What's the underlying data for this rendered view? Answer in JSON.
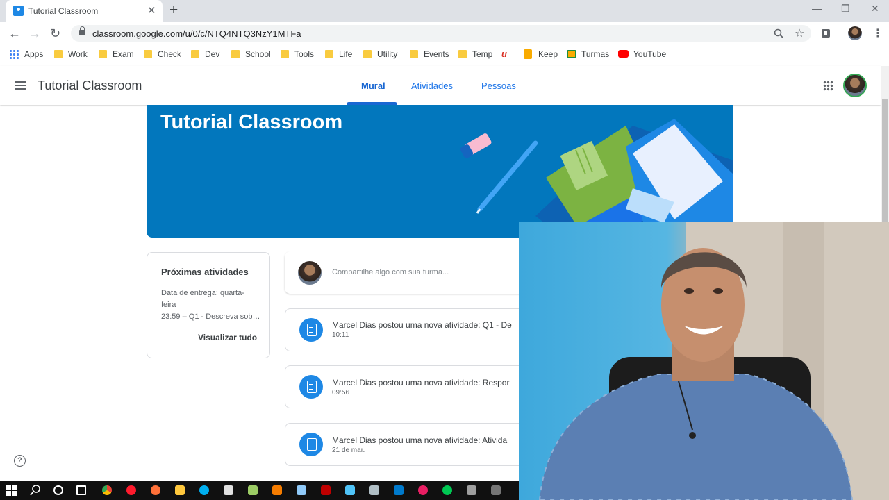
{
  "browser": {
    "tab_title": "Tutorial Classroom",
    "tab_close": "✕",
    "new_tab": "+",
    "url": "classroom.google.com/u/0/c/NTQ4NTQ3NzY1MTFa",
    "bookmarks": [
      "Apps",
      "Work",
      "Exam",
      "Check",
      "Dev",
      "School",
      "Tools",
      "Life",
      "Utility",
      "Events",
      "Temp",
      "Keep",
      "Turmas",
      "YouTube"
    ]
  },
  "appbar": {
    "title": "Tutorial Classroom",
    "tabs": [
      "Mural",
      "Atividades",
      "Pessoas"
    ]
  },
  "banner": {
    "title": "Tutorial Classroom"
  },
  "upcoming": {
    "heading": "Próximas atividades",
    "line1": "Data de entrega: quarta-",
    "line2": "feira",
    "line3": "23:59 – Q1 - Descreva sob…",
    "view_all": "Visualizar tudo"
  },
  "share": {
    "placeholder": "Compartilhe algo com sua turma..."
  },
  "posts": [
    {
      "title": "Marcel Dias postou uma nova atividade: Q1 - De",
      "time": "10:11"
    },
    {
      "title": "Marcel Dias postou uma nova atividade: Respor",
      "time": "09:56"
    },
    {
      "title": "Marcel Dias postou uma nova atividade: Ativida",
      "time": "21 de mar."
    }
  ],
  "help": "?",
  "colors": {
    "accent": "#1967d2",
    "banner": "#0277bd",
    "icon_blue": "#1e88e5"
  }
}
